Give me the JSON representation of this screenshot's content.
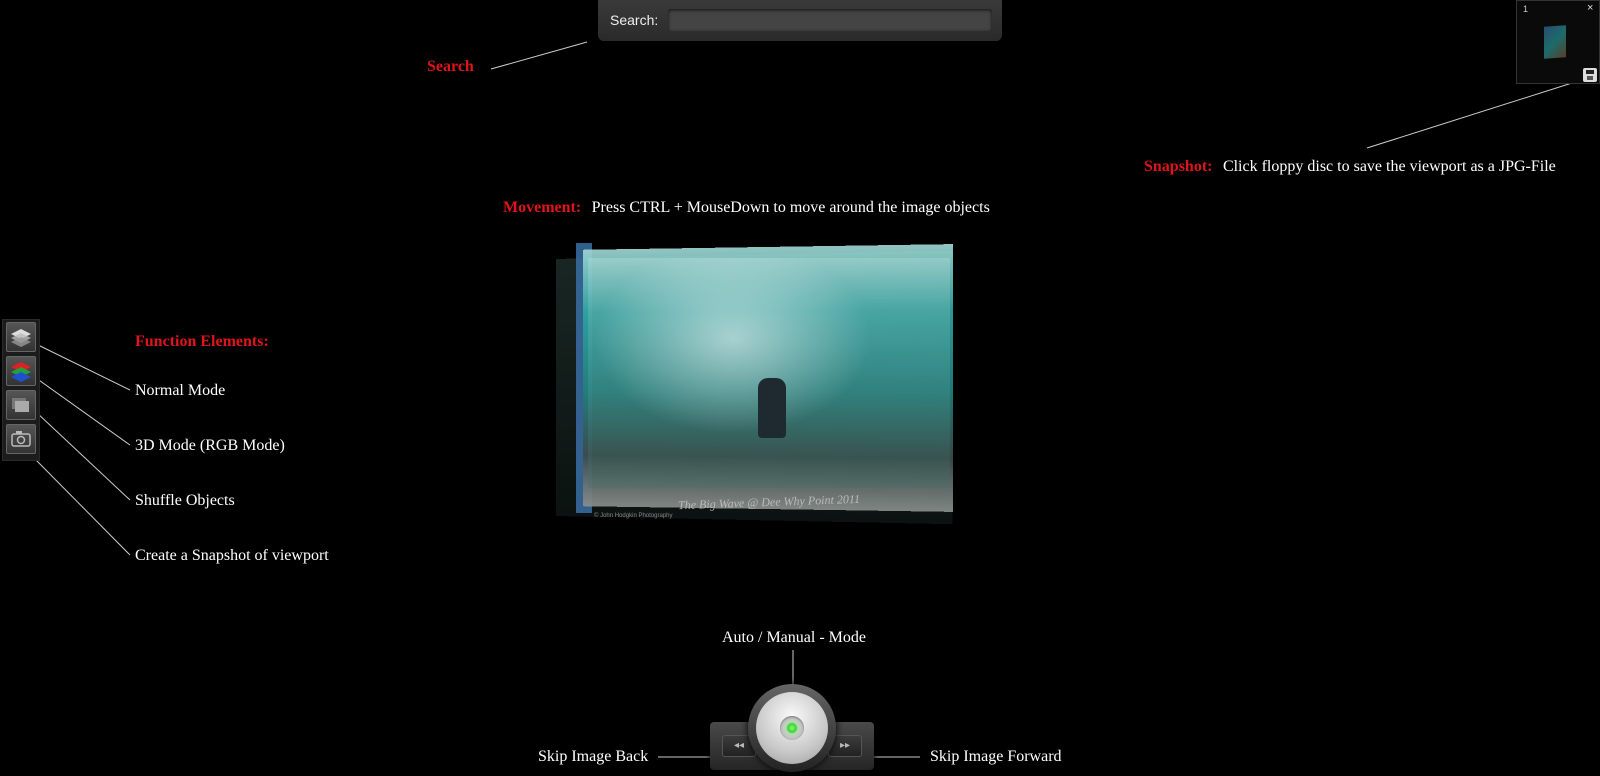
{
  "search": {
    "label": "Search:",
    "placeholder": ""
  },
  "annotations": {
    "search": "Search",
    "snapshot_title": "Snapshot:",
    "snapshot_text": "Click floppy disc to save the viewport as a JPG-File",
    "movement_title": "Movement:",
    "movement_text": "Press CTRL + MouseDown to move around the image objects",
    "functions_title": "Function Elements:",
    "normal_mode": "Normal Mode",
    "mode_3d": "3D Mode (RGB Mode)",
    "shuffle": "Shuffle Objects",
    "create_snapshot": "Create a Snapshot of viewport",
    "auto_manual": "Auto / Manual - Mode",
    "skip_back": "Skip Image Back",
    "skip_forward": "Skip Image Forward"
  },
  "snapshot_panel": {
    "count": "1",
    "close": "×"
  },
  "image": {
    "caption": "The Big Wave @ Dee Why Point 2011",
    "credit": "© John Hodgkin Photography"
  },
  "controls": {
    "back_glyph": "◂◂",
    "forward_glyph": "▸▸"
  },
  "colors": {
    "accent_red": "#e0141b",
    "led_green": "#2fdc23"
  }
}
